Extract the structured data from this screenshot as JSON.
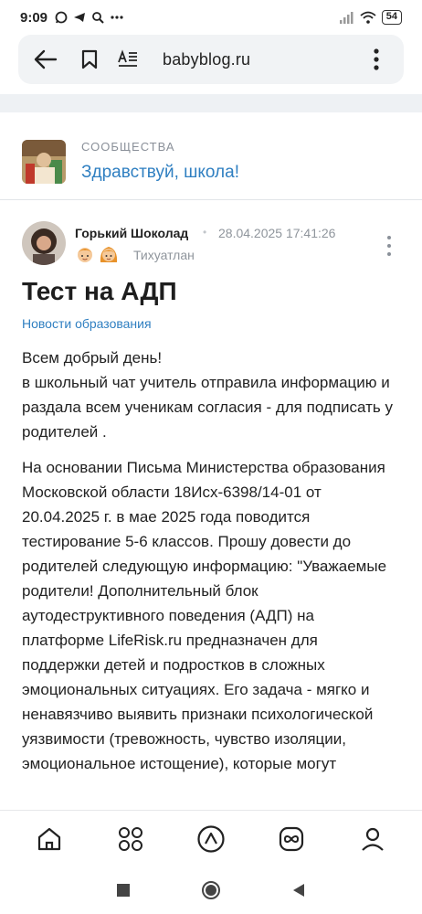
{
  "status_bar": {
    "time": "9:09",
    "battery": "54",
    "icons": [
      "whatsapp-icon",
      "telegram-icon",
      "search-icon",
      "more-icon",
      "signal-icon",
      "wifi-icon",
      "battery-icon"
    ]
  },
  "browser": {
    "url": "babyblog.ru"
  },
  "community": {
    "label": "СООБЩЕСТВА",
    "name": "Здравствуй, школа!"
  },
  "author": {
    "name": "Горький Шоколад",
    "separator": "•",
    "date": "28.04.2025 17:41:26",
    "location": "Тихуатлан"
  },
  "post": {
    "title": "Тест на АДП",
    "tag": "Новости образования",
    "paragraphs": [
      "Всем добрый день!\nв школьный чат учитель отправила информацию и раздала всем ученикам согласия - для подписать у родителей .",
      "На основании Письма Министерства образования Московской области 18Исх-6398/14-01 от 20.04.2025 г. в мае 2025 года поводится тестирование 5-6 классов. Прошу довести до родителей следующую информацию: \"Уважаемые родители! Дополнительный блок аутодеструктивного поведения (АДП) на платформе LifeRisk.ru предназначен для поддержки детей и подростков в сложных эмоциональных ситуациях. Его задача - мягко и ненавязчиво выявить признаки психологической уязвимости (тревожность, чувство изоляции, эмоциональное истощение), которые могут"
    ]
  },
  "bottom_nav": [
    "home-icon",
    "apps-grid-icon",
    "alice-assistant-icon",
    "infinity-icon",
    "profile-icon"
  ],
  "colors": {
    "accent": "#2f7fc1",
    "muted": "#8f959c",
    "band": "#eef1f4"
  }
}
